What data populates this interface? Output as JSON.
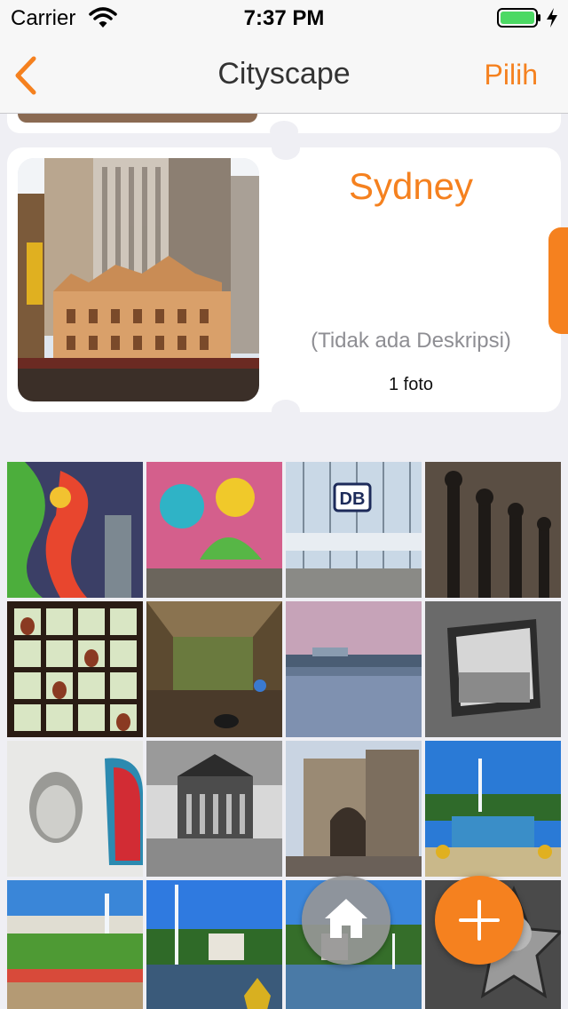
{
  "status_bar": {
    "carrier": "Carrier",
    "time": "7:37 PM",
    "icons": [
      "wifi-icon",
      "battery-icon",
      "charging-bolt-icon"
    ]
  },
  "nav": {
    "back_icon": "chevron-left-icon",
    "title": "Cityscape",
    "action_label": "Pilih"
  },
  "album": {
    "title": "Sydney",
    "description": "(Tidak ada Deskripsi)",
    "count": "1 foto"
  },
  "photos": [
    {
      "name": "graffiti-dragon-photo"
    },
    {
      "name": "graffiti-wall-photo"
    },
    {
      "name": "berlin-hauptbahnhof-photo"
    },
    {
      "name": "iron-fence-photo"
    },
    {
      "name": "window-vases-photo"
    },
    {
      "name": "abandoned-room-photo"
    },
    {
      "name": "river-reflection-photo"
    },
    {
      "name": "window-frame-photo"
    },
    {
      "name": "face-drawing-photo"
    },
    {
      "name": "concert-hall-photo"
    },
    {
      "name": "stone-gate-photo"
    },
    {
      "name": "palace-fountain-photo"
    },
    {
      "name": "palace-garden-photo"
    },
    {
      "name": "fountain-pavilion-photo"
    },
    {
      "name": "fountain-park-photo"
    },
    {
      "name": "star-plaque-photo"
    }
  ],
  "fab": {
    "home_icon": "home-icon",
    "add_icon": "plus-icon"
  },
  "colors": {
    "accent": "#f5811f",
    "background": "#efeff4",
    "card": "#ffffff",
    "secondary_text": "#8e8e93"
  }
}
